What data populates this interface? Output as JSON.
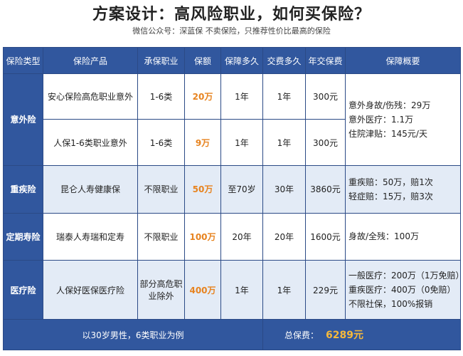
{
  "title": "方案设计：高风险职业，如何买保险？",
  "subtitle": "微信公众号：深蓝保   不卖保险，只推荐性价比最高的保险",
  "headers": [
    "保险类型",
    "保险产品",
    "承保职业",
    "保额",
    "保障多久",
    "交费多久",
    "年交保费",
    "保障概要"
  ],
  "rows": [
    {
      "type": "意外险",
      "product": "安心保险高危职业意外",
      "occupation": "1-6类",
      "amount": "20万",
      "term": "1年",
      "pay": "1年",
      "premium": "300元"
    },
    {
      "product": "人保1-6类职业意外",
      "occupation": "1-6类",
      "amount": "9万",
      "term": "1年",
      "pay": "1年",
      "premium": "300元"
    },
    {
      "type": "重疾险",
      "product": "昆仑人寿健康保",
      "occupation": "不限职业",
      "amount": "50万",
      "term": "至70岁",
      "pay": "30年",
      "premium": "3860元"
    },
    {
      "type": "定期寿险",
      "product": "瑞泰人寿瑞和定寿",
      "occupation": "不限职业",
      "amount": "100万",
      "term": "20年",
      "pay": "20年",
      "premium": "1600元"
    },
    {
      "type": "医疗险",
      "product": "人保好医保医疗险",
      "occupation": "部分高危职业除外",
      "amount": "400万",
      "term": "1年",
      "pay": "1年",
      "premium": "229元"
    }
  ],
  "summaries": {
    "accident": [
      "意外身故/伤残：29万",
      "意外医疗：1.1万",
      "住院津贴：145元/天"
    ],
    "critical": [
      "重疾赔：50万，赔1次",
      "轻症赔：15万，赔3次"
    ],
    "life": [
      "身故/全残：100万"
    ],
    "medical": [
      "一般医疗：200万（1万免赔）",
      "重疾医疗：400万（0免赔）",
      "不限社保，100%报销"
    ]
  },
  "footer": {
    "note": "以30岁男性，6类职业为例",
    "total_label": "总保费：",
    "total_value": "6289元"
  },
  "colors": {
    "header_bg": "#31579e",
    "amount": "#e7831f",
    "total_value": "#f6b93b",
    "row_alt": "#e3ebf6"
  }
}
